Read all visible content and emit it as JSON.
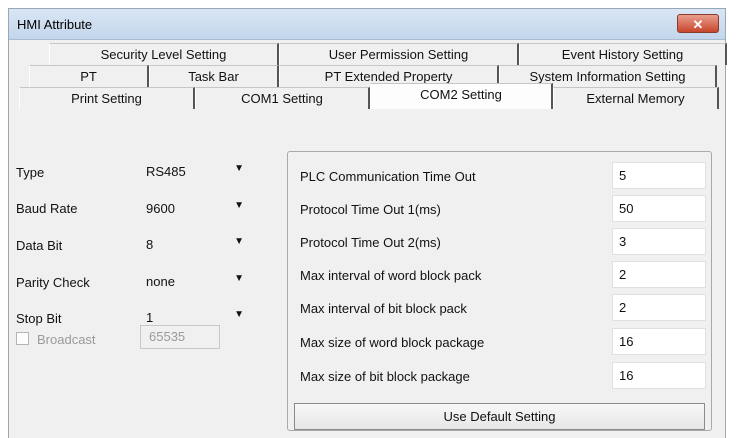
{
  "window": {
    "title": "HMI Attribute",
    "close_glyph": "✕"
  },
  "tabs": {
    "row1": [
      "Security Level Setting",
      "User Permission Setting",
      "Event History Setting"
    ],
    "row2": [
      "PT",
      "Task Bar",
      "PT Extended Property",
      "System Information Setting"
    ],
    "row3": [
      "Print Setting",
      "COM1 Setting",
      "COM2 Setting",
      "External Memory"
    ],
    "active": "COM2 Setting"
  },
  "serial": {
    "type": {
      "label": "Type",
      "value": "RS485"
    },
    "baud_rate": {
      "label": "Baud Rate",
      "value": "9600"
    },
    "data_bit": {
      "label": "Data Bit",
      "value": "8"
    },
    "parity_check": {
      "label": "Parity Check",
      "value": "none"
    },
    "stop_bit": {
      "label": "Stop Bit",
      "value": "1"
    },
    "broadcast": {
      "label": "Broadcast",
      "checked": false,
      "value": "65535"
    },
    "dropdown_arrow_icon": "▼"
  },
  "params": [
    {
      "label": "PLC Communication Time Out",
      "value": "5"
    },
    {
      "label": "Protocol Time Out 1(ms)",
      "value": "50"
    },
    {
      "label": "Protocol Time Out 2(ms)",
      "value": "3"
    },
    {
      "label": "Max interval of word block pack",
      "value": "2"
    },
    {
      "label": "Max interval of bit block pack",
      "value": "2"
    },
    {
      "label": "Max size of word block package",
      "value": "16"
    },
    {
      "label": "Max size of bit block package",
      "value": "16"
    }
  ],
  "buttons": {
    "use_default": "Use Default Setting"
  }
}
